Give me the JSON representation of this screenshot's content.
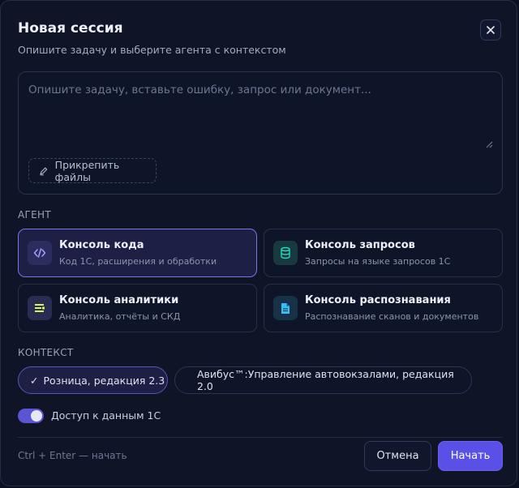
{
  "dialog": {
    "title": "Новая сессия",
    "subtitle": "Опишите задачу и выберите агента с контекстом",
    "close_icon": "close-icon"
  },
  "task_input": {
    "value": "",
    "placeholder": "Опишите задачу, вставьте ошибку, запрос или документ...",
    "attach_label": "Прикрепить файлы",
    "attach_icon": "pen-icon"
  },
  "agents": {
    "section_label": "АГЕНТ",
    "items": [
      {
        "title": "Консоль кода",
        "description": "Код 1С, расширения и обработки",
        "icon": "code-icon",
        "selected": true
      },
      {
        "title": "Консоль запросов",
        "description": "Запросы на языке запросов 1С",
        "icon": "database-icon",
        "selected": false
      },
      {
        "title": "Консоль аналитики",
        "description": "Аналитика, отчёты и СКД",
        "icon": "report-icon",
        "selected": false
      },
      {
        "title": "Консоль распознавания",
        "description": "Распознавание сканов и документов",
        "icon": "document-icon",
        "selected": false
      }
    ]
  },
  "context": {
    "section_label": "КОНТЕКСТ",
    "check_mark": "✓",
    "items": [
      {
        "label": "Розница, редакция 2.3",
        "selected": true
      },
      {
        "label": "Авибус™:Управление автовокзалами, редакция 2.0",
        "selected": false
      }
    ]
  },
  "data_access": {
    "label": "Доступ к данным 1С",
    "enabled": true
  },
  "footer": {
    "hint": "Ctrl + Enter — начать",
    "cancel_label": "Отмена",
    "start_label": "Начать"
  },
  "colors": {
    "accent": "#5a50e8",
    "selected_card_bg": "#1e1f45",
    "selected_card_border": "#7c74e6",
    "dialog_bg": "#0f1426"
  }
}
